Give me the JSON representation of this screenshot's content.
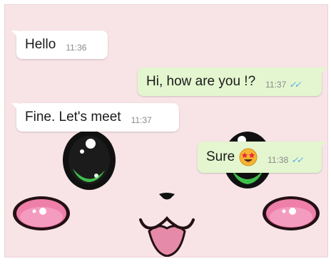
{
  "messages": [
    {
      "direction": "incoming",
      "text": "Hello",
      "time": "11:36"
    },
    {
      "direction": "outgoing",
      "text": "Hi, how are you !?",
      "time": "11:37",
      "status": "✓✓"
    },
    {
      "direction": "incoming",
      "text": "Fine. Let's meet",
      "time": "11:37"
    },
    {
      "direction": "outgoing",
      "text": "Sure",
      "time": "11:38",
      "status": "✓✓",
      "emoji": "star-struck-emoji"
    }
  ],
  "colors": {
    "wallpaper": "#f8e4e7",
    "incoming_bubble": "#ffffff",
    "outgoing_bubble": "#e3f6cf",
    "read_ticks": "#4fa9e6",
    "eye_green": "#3fbf4a",
    "cheek_pink": "#ee7fa8"
  }
}
